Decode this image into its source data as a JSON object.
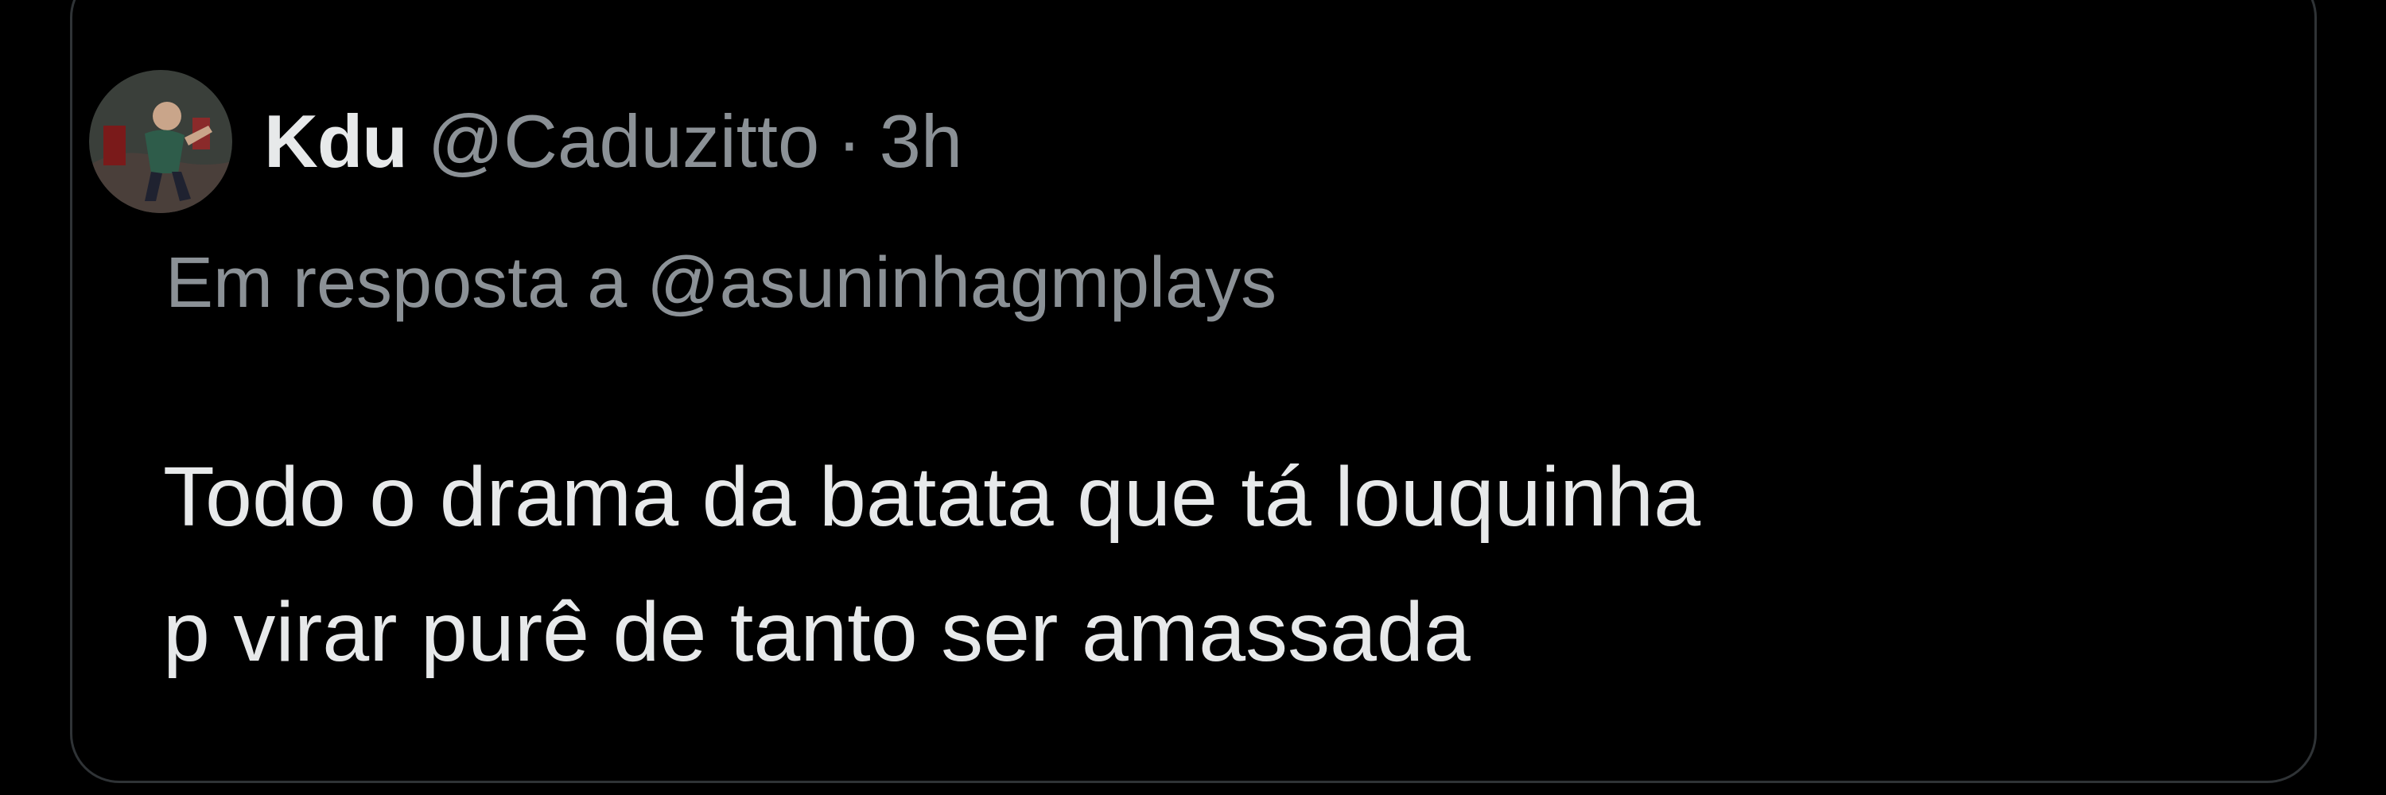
{
  "tweet": {
    "display_name": "Kdu",
    "handle": "@Caduzitto",
    "separator": "·",
    "time": "3h",
    "reply_prefix": "Em resposta a",
    "reply_to": "@asuninhagmplays",
    "text_lines": [
      "Todo o drama da batata que tá louquinha",
      "p virar purê de tanto ser amassada"
    ]
  },
  "colors": {
    "background": "#000000",
    "primary_text": "#e7e9ea",
    "secondary_text": "#8b9196",
    "card_border": "#2f3336"
  }
}
